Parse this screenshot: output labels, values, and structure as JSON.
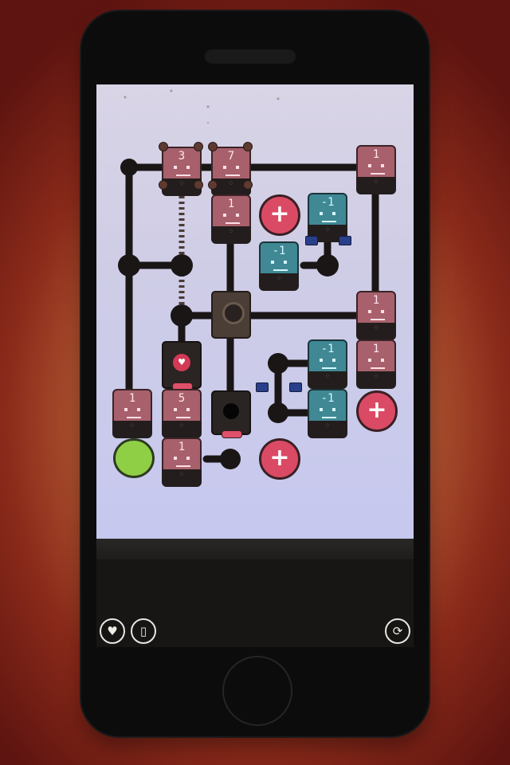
{
  "board": {
    "tiles": [
      {
        "id": "tile-a",
        "value": "3",
        "color": "pink"
      },
      {
        "id": "tile-b",
        "value": "7",
        "color": "pink"
      },
      {
        "id": "tile-c",
        "value": "1",
        "color": "pink"
      },
      {
        "id": "tile-d",
        "value": "1",
        "color": "pink"
      },
      {
        "id": "tile-e",
        "value": "-1",
        "color": "cyan"
      },
      {
        "id": "tile-f",
        "value": "-1",
        "color": "cyan"
      },
      {
        "id": "tile-g",
        "value": "1",
        "color": "pink"
      },
      {
        "id": "tile-h",
        "value": "-1",
        "color": "cyan"
      },
      {
        "id": "tile-i",
        "value": "1",
        "color": "pink"
      },
      {
        "id": "tile-j",
        "value": "-1",
        "color": "cyan"
      },
      {
        "id": "tile-k",
        "value": "1",
        "color": "pink"
      },
      {
        "id": "tile-l",
        "value": "5",
        "color": "pink"
      },
      {
        "id": "tile-m",
        "value": "1",
        "color": "pink"
      }
    ],
    "plus_symbol": "+",
    "colors": {
      "pink": "#a8606c",
      "cyan": "#3f8894",
      "plus": "#db4a64",
      "goal": "#8fcf46",
      "pipe": "#1b1616"
    }
  },
  "toolbar": {
    "hint_icon": "heart-icon",
    "device_icon": "phone-icon",
    "restart_icon": "restart-icon"
  }
}
